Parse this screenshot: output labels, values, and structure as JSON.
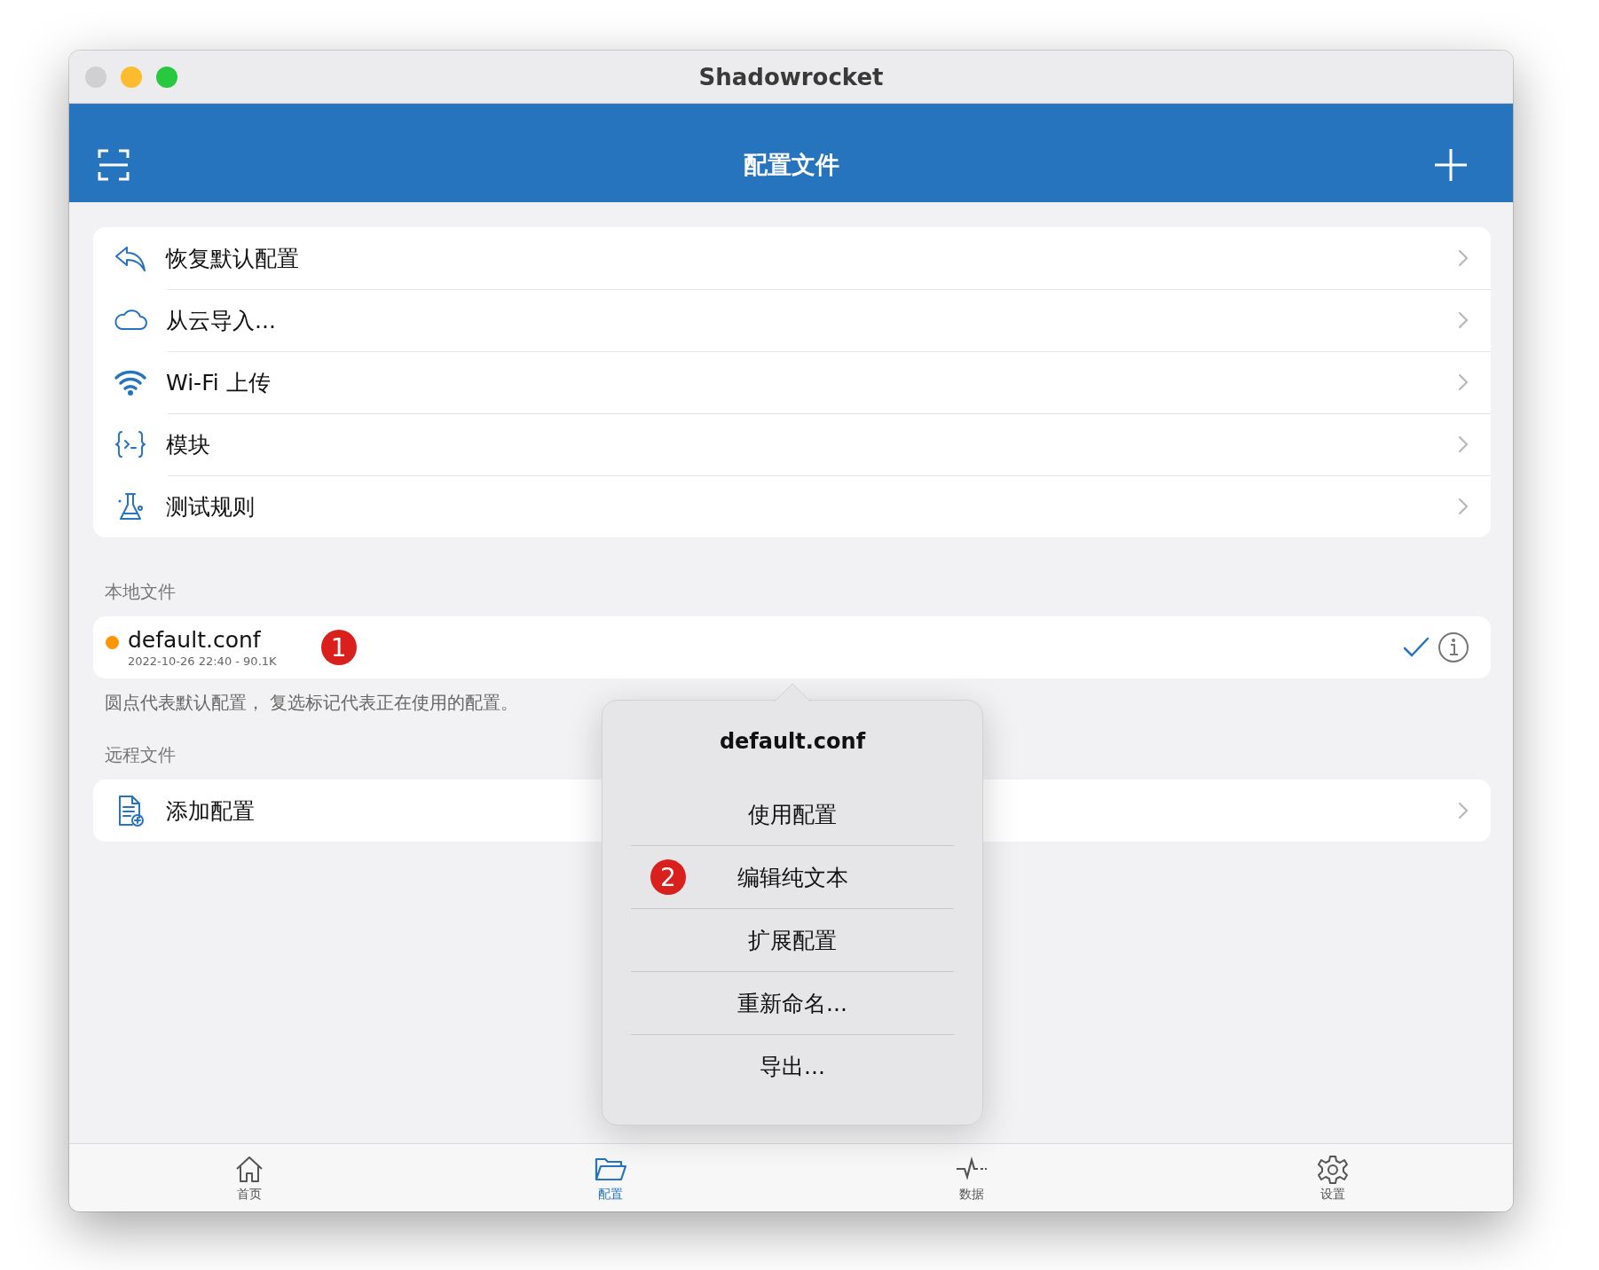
{
  "window": {
    "title": "Shadowrocket"
  },
  "nav": {
    "title": "配置文件"
  },
  "actions": [
    {
      "kind": "undo",
      "label": "恢复默认配置"
    },
    {
      "kind": "cloud",
      "label": "从云导入..."
    },
    {
      "kind": "wifi",
      "label": "Wi-Fi 上传"
    },
    {
      "kind": "module",
      "label": "模块"
    },
    {
      "kind": "flask",
      "label": "测试规则"
    }
  ],
  "local_files": {
    "header": "本地文件",
    "files": [
      {
        "name": "default.conf",
        "meta": "2022-10-26 22:40 - 90.1K",
        "default": true,
        "in_use": true,
        "badge": "1"
      }
    ],
    "note": "圆点代表默认配置， 复选标记代表正在使用的配置。"
  },
  "remote_files": {
    "header": "远程文件",
    "items": [
      {
        "kind": "add-file",
        "label": "添加配置"
      }
    ]
  },
  "popover": {
    "title": "default.conf",
    "items": [
      {
        "label": "使用配置"
      },
      {
        "label": "编辑纯文本",
        "badge": "2"
      },
      {
        "label": "扩展配置"
      },
      {
        "label": "重新命名..."
      },
      {
        "label": "导出..."
      }
    ]
  },
  "tab_bar": [
    {
      "kind": "home",
      "label": "首页",
      "selected": false
    },
    {
      "kind": "folder",
      "label": "配置",
      "selected": true
    },
    {
      "kind": "pulse",
      "label": "数据",
      "selected": false
    },
    {
      "kind": "gear",
      "label": "设置",
      "selected": false
    }
  ]
}
